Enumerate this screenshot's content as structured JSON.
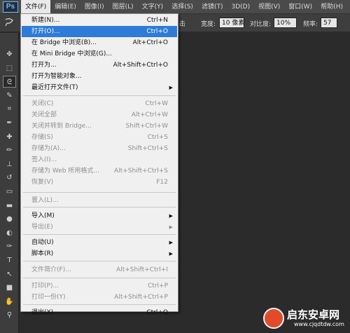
{
  "app": {
    "logo_text": "Ps"
  },
  "menubar": [
    {
      "id": "file",
      "label": "文件(F)"
    },
    {
      "id": "edit",
      "label": "编辑(E)"
    },
    {
      "id": "image",
      "label": "图像(I)"
    },
    {
      "id": "layer",
      "label": "图层(L)"
    },
    {
      "id": "type",
      "label": "文字(Y)"
    },
    {
      "id": "select",
      "label": "选择(S)"
    },
    {
      "id": "filter",
      "label": "滤镜(T)"
    },
    {
      "id": "3d",
      "label": "3D(D)"
    },
    {
      "id": "view",
      "label": "视图(V)"
    },
    {
      "id": "window",
      "label": "窗口(W)"
    },
    {
      "id": "help",
      "label": "帮助(H)"
    }
  ],
  "options": {
    "partial_label": "击",
    "width_label": "宽度:",
    "width_value": "10 像素",
    "contrast_label": "对比度:",
    "contrast_value": "10%",
    "frequency_label": "频率:",
    "frequency_value": "57"
  },
  "file_menu": {
    "items": [
      {
        "label": "新建(N)...",
        "shortcut": "Ctrl+N",
        "enabled": true
      },
      {
        "label": "打开(O)...",
        "shortcut": "Ctrl+O",
        "enabled": true,
        "highlighted": true
      },
      {
        "label": "在 Bridge 中浏览(B)...",
        "shortcut": "Alt+Ctrl+O",
        "enabled": true
      },
      {
        "label": "在 Mini Bridge 中浏览(G)...",
        "shortcut": "",
        "enabled": true
      },
      {
        "label": "打开为...",
        "shortcut": "Alt+Shift+Ctrl+O",
        "enabled": true
      },
      {
        "label": "打开为智能对象...",
        "shortcut": "",
        "enabled": true
      },
      {
        "label": "最近打开文件(T)",
        "shortcut": "",
        "enabled": true,
        "submenu": true
      },
      {
        "label": "关闭(C)",
        "shortcut": "Ctrl+W",
        "enabled": false
      },
      {
        "label": "关闭全部",
        "shortcut": "Alt+Ctrl+W",
        "enabled": false
      },
      {
        "label": "关闭并转到 Bridge...",
        "shortcut": "Shift+Ctrl+W",
        "enabled": false
      },
      {
        "label": "存储(S)",
        "shortcut": "Ctrl+S",
        "enabled": false
      },
      {
        "label": "存储为(A)...",
        "shortcut": "Shift+Ctrl+S",
        "enabled": false
      },
      {
        "label": "签入(I)...",
        "shortcut": "",
        "enabled": false
      },
      {
        "label": "存储为 Web 所用格式...",
        "shortcut": "Alt+Shift+Ctrl+S",
        "enabled": false
      },
      {
        "label": "恢复(V)",
        "shortcut": "F12",
        "enabled": false
      },
      {
        "label": "置入(L)...",
        "shortcut": "",
        "enabled": false
      },
      {
        "label": "导入(M)",
        "shortcut": "",
        "enabled": true,
        "submenu": true
      },
      {
        "label": "导出(E)",
        "shortcut": "",
        "enabled": false,
        "submenu": true
      },
      {
        "label": "自动(U)",
        "shortcut": "",
        "enabled": true,
        "submenu": true
      },
      {
        "label": "脚本(R)",
        "shortcut": "",
        "enabled": true,
        "submenu": true
      },
      {
        "label": "文件简介(F)...",
        "shortcut": "Alt+Shift+Ctrl+I",
        "enabled": false
      },
      {
        "label": "打印(P)...",
        "shortcut": "Ctrl+P",
        "enabled": false
      },
      {
        "label": "打印一份(Y)",
        "shortcut": "Alt+Shift+Ctrl+P",
        "enabled": false
      },
      {
        "label": "退出(X)",
        "shortcut": "Ctrl+Q",
        "enabled": true
      }
    ]
  },
  "toolbar_icons": [
    "move-tool-icon",
    "marquee-tool-icon",
    "lasso-tool-icon",
    "quick-selection-tool-icon",
    "crop-tool-icon",
    "eyedropper-tool-icon",
    "healing-brush-tool-icon",
    "brush-tool-icon",
    "clone-stamp-tool-icon",
    "history-brush-tool-icon",
    "eraser-tool-icon",
    "gradient-tool-icon",
    "blur-tool-icon",
    "dodge-tool-icon",
    "pen-tool-icon",
    "type-tool-icon",
    "path-selection-tool-icon",
    "shape-tool-icon",
    "hand-tool-icon",
    "zoom-tool-icon"
  ],
  "watermark": {
    "title": "启东安卓网",
    "url": "www.cjqdtdw.com"
  },
  "colors": {
    "highlight": "#2e7bd8",
    "menu_bg": "#f0f0f0",
    "canvas_bg": "#2b2b2b"
  }
}
